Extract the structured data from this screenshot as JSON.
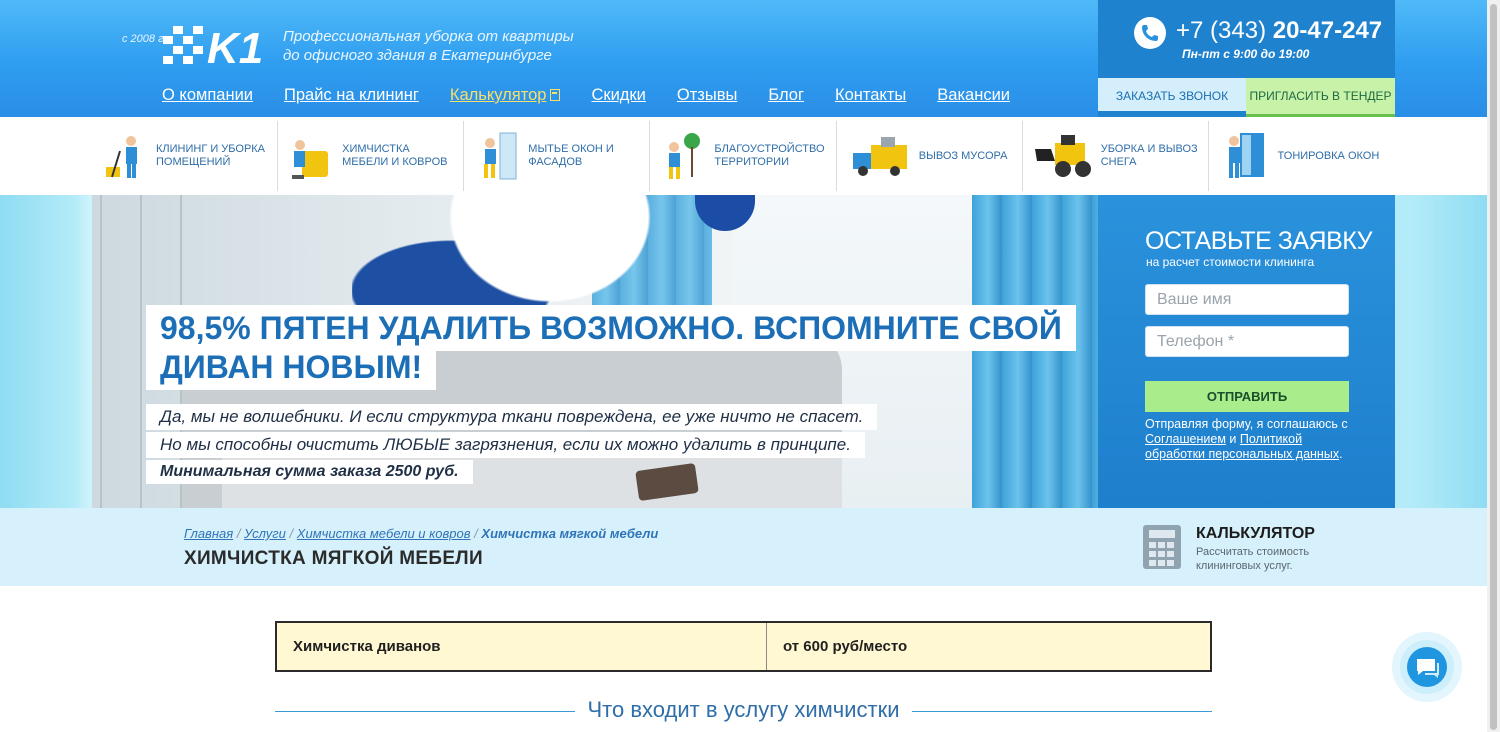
{
  "header": {
    "since": "с 2008 г.",
    "logo_text": "K1",
    "tagline_line1": "Профессиональная уборка от квартиры",
    "tagline_line2": "до офисного здания в Екатеринбурге",
    "nav": [
      {
        "label": "О компании"
      },
      {
        "label": "Прайс на клининг"
      },
      {
        "label": "Калькулятор"
      },
      {
        "label": "Скидки"
      },
      {
        "label": "Отзывы"
      },
      {
        "label": "Блог"
      },
      {
        "label": "Контакты"
      },
      {
        "label": "Вакансии"
      }
    ],
    "phone_prefix": "+7 (343)",
    "phone_main": "20-47-247",
    "hours": "Пн-пт с 9:00 до 19:00",
    "btn_call": "ЗАКАЗАТЬ ЗВОНОК",
    "btn_tender": "ПРИГЛАСИТЬ В ТЕНДЕР"
  },
  "services": [
    {
      "label": "КЛИНИНГ И УБОРКА ПОМЕЩЕНИЙ",
      "icon": "cleaner-icon"
    },
    {
      "label": "ХИМЧИСТКА МЕБЕЛИ И КОВРОВ",
      "icon": "dry-cleaning-icon"
    },
    {
      "label": "МЫТЬЕ ОКОН И ФАСАДОВ",
      "icon": "window-washing-icon"
    },
    {
      "label": "БЛАГОУСТРОЙСТВО ТЕРРИТОРИИ",
      "icon": "landscaping-icon"
    },
    {
      "label": "ВЫВОЗ МУСОРА",
      "icon": "garbage-truck-icon"
    },
    {
      "label": "УБОРКА И ВЫВОЗ СНЕГА",
      "icon": "snow-loader-icon"
    },
    {
      "label": "ТОНИРОВКА ОКОН",
      "icon": "window-tinting-icon"
    }
  ],
  "hero": {
    "title_line1": "98,5% ПЯТЕН УДАЛИТЬ ВОЗМОЖНО. ВСПОМНИТЕ СВОЙ",
    "title_line2": "ДИВАН НОВЫМ!",
    "text_line1": "Да, мы не волшебники. И если структура ткани повреждена, ее уже ничто не спасет.",
    "text_line2": "Но мы способны очистить ЛЮБЫЕ загрязнения, если их можно удалить в принципе.",
    "text_line3": "Минимальная сумма заказа 2500 руб."
  },
  "form": {
    "title": "ОСТАВЬТЕ ЗАЯВКУ",
    "subtitle": "на расчет стоимости клининга",
    "name_placeholder": "Ваше имя",
    "phone_placeholder": "Телефон *",
    "submit": "ОТПРАВИТЬ",
    "note_prefix": "Отправляя форму, я соглашаюсь с",
    "link_agreement": "Соглашением",
    "note_and": "и",
    "link_policy": "Политикой обработки персональных данных"
  },
  "breadcrumb": {
    "items": [
      "Главная",
      "Услуги",
      "Химчистка мебели и ковров"
    ],
    "current": "Химчистка мягкой мебели",
    "separator": "/"
  },
  "page_title": "ХИМЧИСТКА МЯГКОЙ МЕБЕЛИ",
  "calculator": {
    "title": "КАЛЬКУЛЯТОР",
    "subtitle": "Рассчитать стоимость клининговых услуг."
  },
  "price_table": {
    "rows": [
      {
        "service": "Химчистка диванов",
        "price": "от 600 руб/место"
      }
    ]
  },
  "section_heading": "Что входит в услугу химчистки",
  "colors": {
    "header_blue": "#2f9df0",
    "accent_yellow": "#f6e06b",
    "brand_blue": "#1c6fb6",
    "green_button": "#a8ec8c"
  }
}
